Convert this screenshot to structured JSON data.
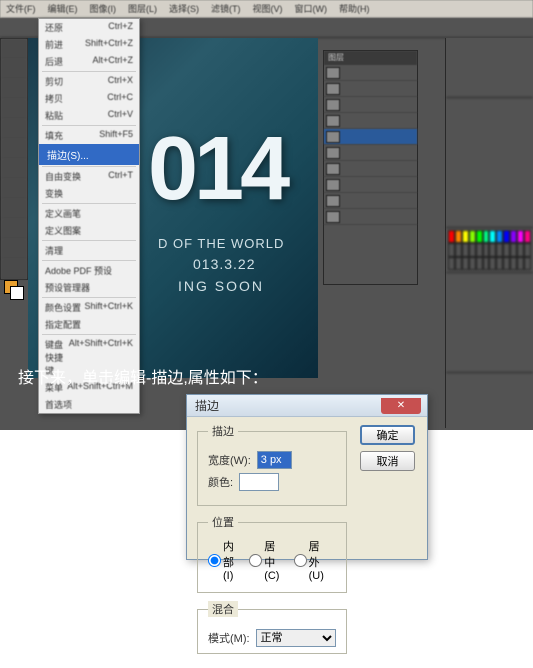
{
  "menubar": [
    "文件(F)",
    "编辑(E)",
    "图像(I)",
    "图层(L)",
    "选择(S)",
    "滤镜(T)",
    "视图(V)",
    "窗口(W)",
    "帮助(H)"
  ],
  "canvas": {
    "big_text": "014",
    "sub1": "D OF THE WORLD",
    "sub2": "013.3.22",
    "sub3": "ING SOON"
  },
  "dropdown": {
    "highlighted": "描边(S)..."
  },
  "layers": {
    "title": "图层"
  },
  "caption": "接下来，单击编辑-描边,属性如下：",
  "dialog": {
    "title": "描边",
    "ok_label": "确定",
    "cancel_label": "取消",
    "group_stroke": "描边",
    "width_label": "宽度(W):",
    "width_value": "3 px",
    "color_label": "颜色:",
    "group_position": "位置",
    "pos_inside": "内部(I)",
    "pos_center": "居中(C)",
    "pos_outside": "居外(U)",
    "group_blend": "混合",
    "mode_label": "模式(M):",
    "mode_value": "正常"
  }
}
